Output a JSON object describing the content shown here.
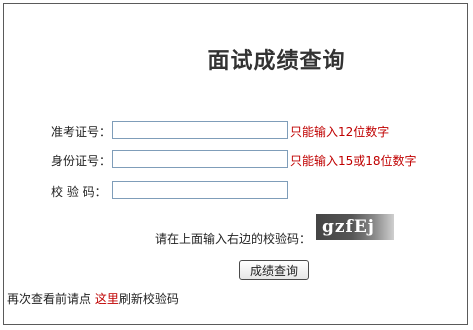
{
  "form": {
    "title": "面试成绩查询",
    "admission_label": "准考证号：",
    "admission_value": "",
    "admission_hint": "只能输入12位数字",
    "id_label": "身份证号：",
    "id_value": "",
    "id_hint": "只能输入15或18位数字",
    "captcha_label": "校 验 码：",
    "captcha_value": "",
    "captcha_prompt": "请在上面输入右边的校验码：",
    "captcha_text": "gzfEj",
    "submit_label": "成绩查询"
  },
  "footer": {
    "prefix": "再次查看前请点",
    "link": "这里",
    "suffix": "刷新校验码"
  }
}
